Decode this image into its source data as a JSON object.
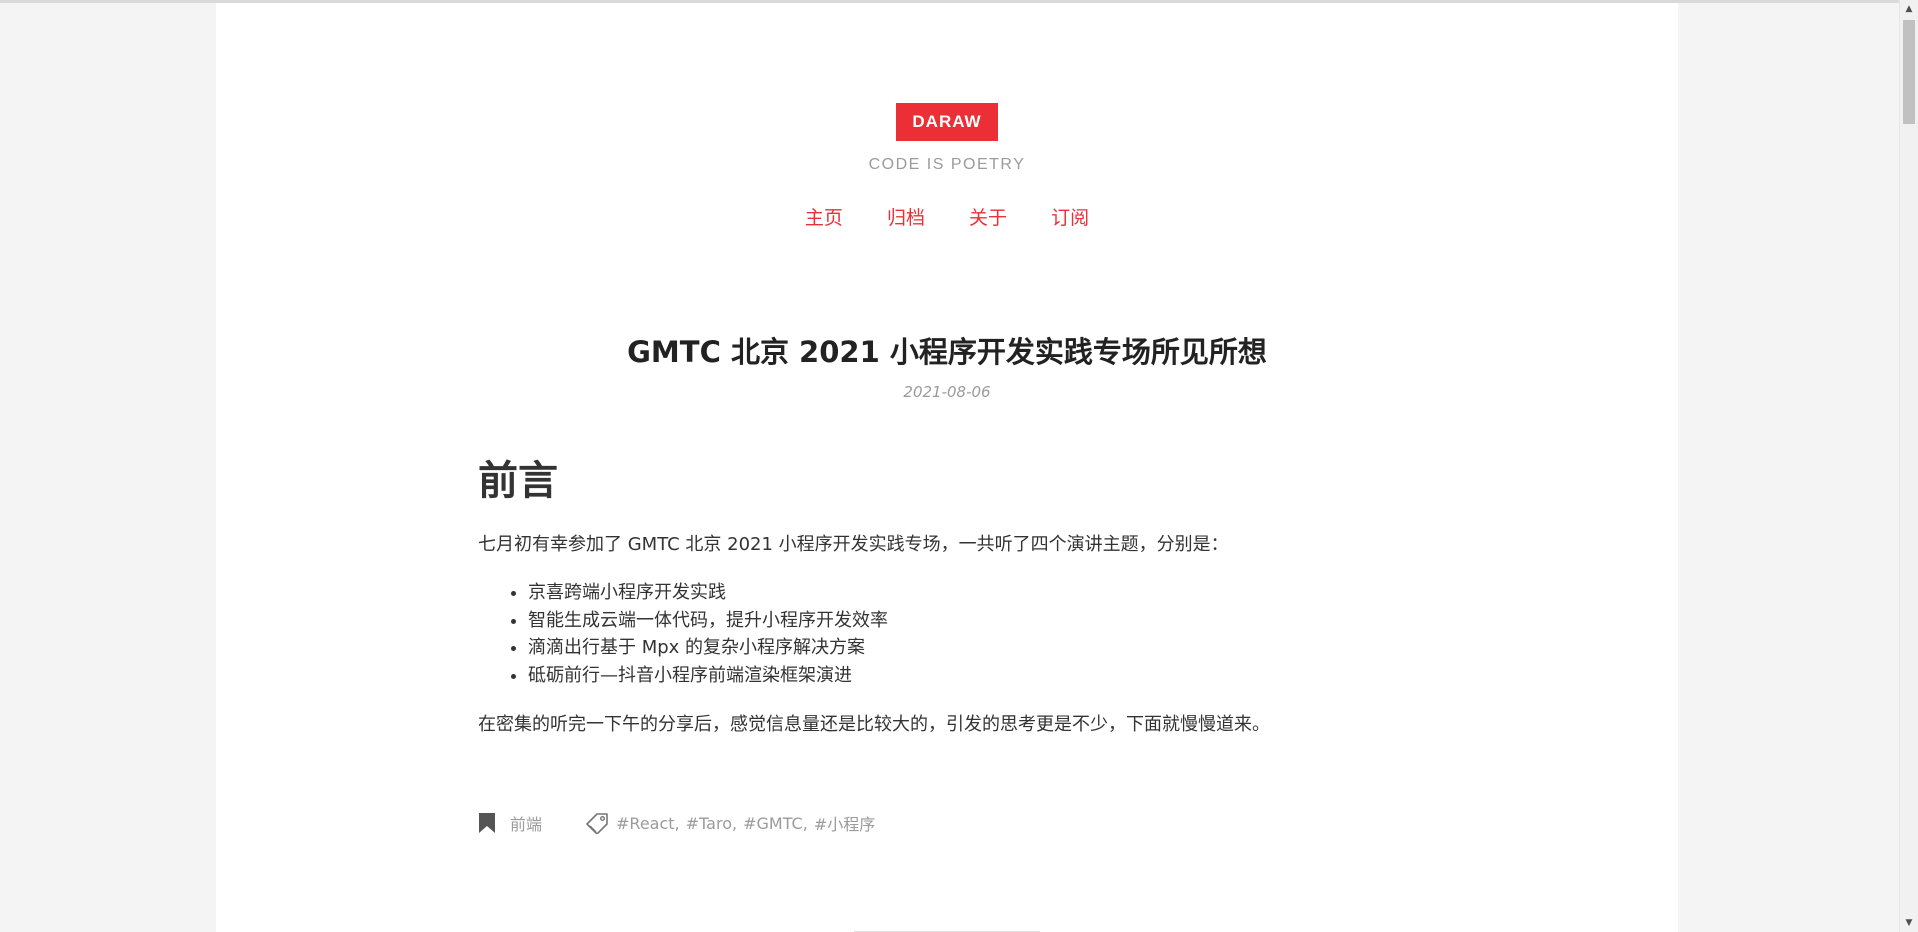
{
  "site": {
    "logo": "DARAW",
    "tagline": "CODE IS POETRY",
    "nav": [
      "主页",
      "归档",
      "关于",
      "订阅"
    ]
  },
  "post": {
    "title": "GMTC 北京 2021 小程序开发实践专场所见所想",
    "date": "2021-08-06",
    "heading": "前言",
    "intro": "七月初有幸参加了 GMTC 北京 2021 小程序开发实践专场，一共听了四个演讲主题，分别是：",
    "topics": [
      "京喜跨端小程序开发实践",
      "智能生成云端一体代码，提升小程序开发效率",
      "滴滴出行基于 Mpx 的复杂小程序解决方案",
      "砥砺前行—抖音小程序前端渲染框架演进"
    ],
    "outro": "在密集的听完一下午的分享后，感觉信息量还是比较大的，引发的思考更是不少，下面就慢慢道来。",
    "category": "前端",
    "tags": [
      "#React",
      "#Taro",
      "#GMTC",
      "#小程序"
    ]
  },
  "colors": {
    "accent": "#ec2f36",
    "muted": "#9b9b9b",
    "background": "#f4f4f4"
  },
  "icons": {
    "category": "bookmark-icon",
    "tags": "tag-icon"
  }
}
